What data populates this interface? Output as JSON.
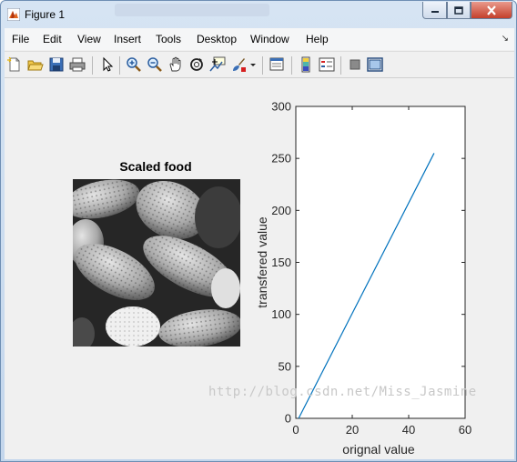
{
  "window": {
    "title": "Figure 1"
  },
  "menu": [
    "File",
    "Edit",
    "View",
    "Insert",
    "Tools",
    "Desktop",
    "Window",
    "Help"
  ],
  "toolbar_icons": [
    "new-figure-icon",
    "open-file-icon",
    "save-icon",
    "print-icon",
    "pointer-icon",
    "zoom-in-icon",
    "zoom-out-icon",
    "pan-icon",
    "rotate-icon",
    "data-cursor-icon",
    "brush-icon",
    "brush-dropdown-icon",
    "link-plot-icon",
    "colorbar-icon",
    "legend-icon",
    "hide-plot-tools-icon",
    "show-plot-tools-icon"
  ],
  "image_panel": {
    "title": "Scaled food"
  },
  "chart_data": {
    "type": "line",
    "title": "",
    "xlabel": "orignal value",
    "ylabel": "transfered value",
    "xlim": [
      0,
      60
    ],
    "ylim": [
      0,
      300
    ],
    "xticks": [
      0,
      20,
      40,
      60
    ],
    "yticks": [
      0,
      50,
      100,
      150,
      200,
      250,
      300
    ],
    "series": [
      {
        "x": [
          1,
          49
        ],
        "y": [
          0,
          255
        ]
      }
    ],
    "line_color": "#0072bd",
    "grid": false
  },
  "watermark": "http://blog.csdn.net/Miss_Jasmine"
}
